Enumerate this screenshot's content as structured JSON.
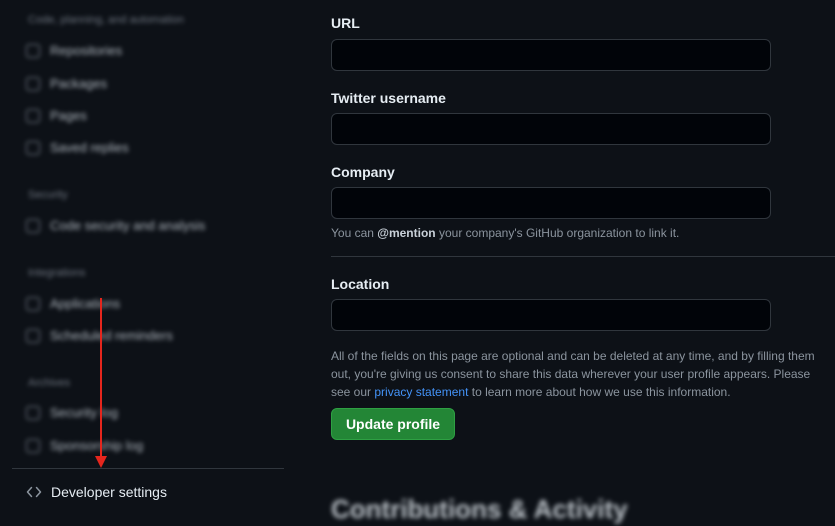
{
  "sidebar": {
    "sections": [
      {
        "heading": "Code, planning, and automation",
        "items": [
          {
            "label": "Repositories",
            "icon": "repo-icon"
          },
          {
            "label": "Packages",
            "icon": "package-icon"
          },
          {
            "label": "Pages",
            "icon": "browser-icon"
          },
          {
            "label": "Saved replies",
            "icon": "reply-icon"
          }
        ]
      },
      {
        "heading": "Security",
        "items": [
          {
            "label": "Code security and analysis",
            "icon": "shield-icon"
          }
        ]
      },
      {
        "heading": "Integrations",
        "items": [
          {
            "label": "Applications",
            "icon": "apps-icon"
          },
          {
            "label": "Scheduled reminders",
            "icon": "clock-icon"
          }
        ]
      },
      {
        "heading": "Archives",
        "items": [
          {
            "label": "Security log",
            "icon": "log-icon"
          },
          {
            "label": "Sponsorship log",
            "icon": "log-icon"
          }
        ]
      }
    ],
    "developer_settings": {
      "label": "Developer settings",
      "icon": "code-icon"
    }
  },
  "form": {
    "url": {
      "label": "URL",
      "value": ""
    },
    "twitter": {
      "label": "Twitter username",
      "value": ""
    },
    "company": {
      "label": "Company",
      "value": "",
      "note_prefix": "You can ",
      "note_mention": "@mention",
      "note_suffix": " your company's GitHub organization to link it."
    },
    "location": {
      "label": "Location",
      "value": ""
    },
    "privacy": {
      "text_before": "All of the fields on this page are optional and can be deleted at any time, and by filling them out, you're giving us consent to share this data wherever your user profile appears. Please see our ",
      "link": "privacy statement",
      "text_after": " to learn more about how we use this information."
    },
    "update_button": "Update profile"
  },
  "next_section_heading": "Contributions & Activity",
  "colors": {
    "background": "#0d1117",
    "accent_button": "#238636",
    "link": "#4493f8",
    "annotation_arrow": "#e5261d"
  }
}
